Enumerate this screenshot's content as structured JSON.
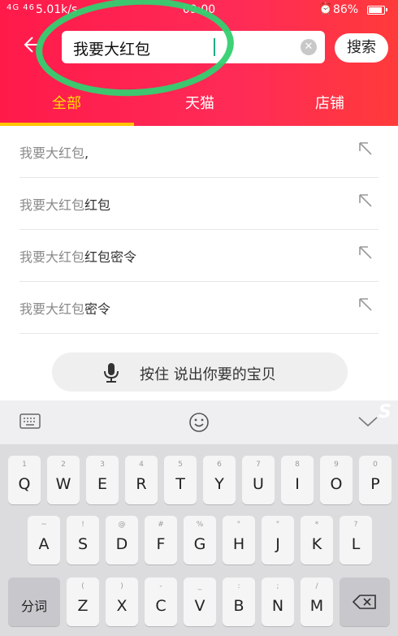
{
  "status_bar": {
    "signal": "4G 46",
    "network_speed": "5.01k/s",
    "time": "09:00",
    "battery": "86%"
  },
  "search": {
    "query": "我要大红包",
    "button_label": "搜索"
  },
  "tabs": [
    {
      "label": "全部",
      "active": true
    },
    {
      "label": "天猫",
      "active": false
    },
    {
      "label": "店铺",
      "active": false
    }
  ],
  "suggestions": [
    {
      "prefix": "我要大红包",
      "suffix": ","
    },
    {
      "prefix": "我要大红包",
      "suffix": "红包"
    },
    {
      "prefix": "我要大红包",
      "suffix": "红包密令"
    },
    {
      "prefix": "我要大红包",
      "suffix": "密令"
    }
  ],
  "voice": {
    "label": "按住 说出你要的宝贝"
  },
  "keyboard": {
    "row1": [
      {
        "main": "Q",
        "sub": "1"
      },
      {
        "main": "W",
        "sub": "2"
      },
      {
        "main": "E",
        "sub": "3"
      },
      {
        "main": "R",
        "sub": "4"
      },
      {
        "main": "T",
        "sub": "5"
      },
      {
        "main": "Y",
        "sub": "6"
      },
      {
        "main": "U",
        "sub": "7"
      },
      {
        "main": "I",
        "sub": "8"
      },
      {
        "main": "O",
        "sub": "9"
      },
      {
        "main": "P",
        "sub": "0"
      }
    ],
    "row2": [
      {
        "main": "A",
        "sub": "~"
      },
      {
        "main": "S",
        "sub": "!"
      },
      {
        "main": "D",
        "sub": "@"
      },
      {
        "main": "F",
        "sub": "#"
      },
      {
        "main": "G",
        "sub": "%"
      },
      {
        "main": "H",
        "sub": "\""
      },
      {
        "main": "J",
        "sub": "\""
      },
      {
        "main": "K",
        "sub": "*"
      },
      {
        "main": "L",
        "sub": "?"
      }
    ],
    "row3": [
      {
        "main": "Z",
        "sub": "("
      },
      {
        "main": "X",
        "sub": ")"
      },
      {
        "main": "C",
        "sub": "-"
      },
      {
        "main": "V",
        "sub": "_"
      },
      {
        "main": "B",
        "sub": ":"
      },
      {
        "main": "N",
        "sub": ";"
      },
      {
        "main": "M",
        "sub": "/"
      }
    ],
    "fn_left": "分词",
    "toolbar_logo": "S"
  },
  "colors": {
    "brand_red": "#ff2451",
    "active_tab": "#ffde00",
    "annotation_green": "#33d070"
  }
}
